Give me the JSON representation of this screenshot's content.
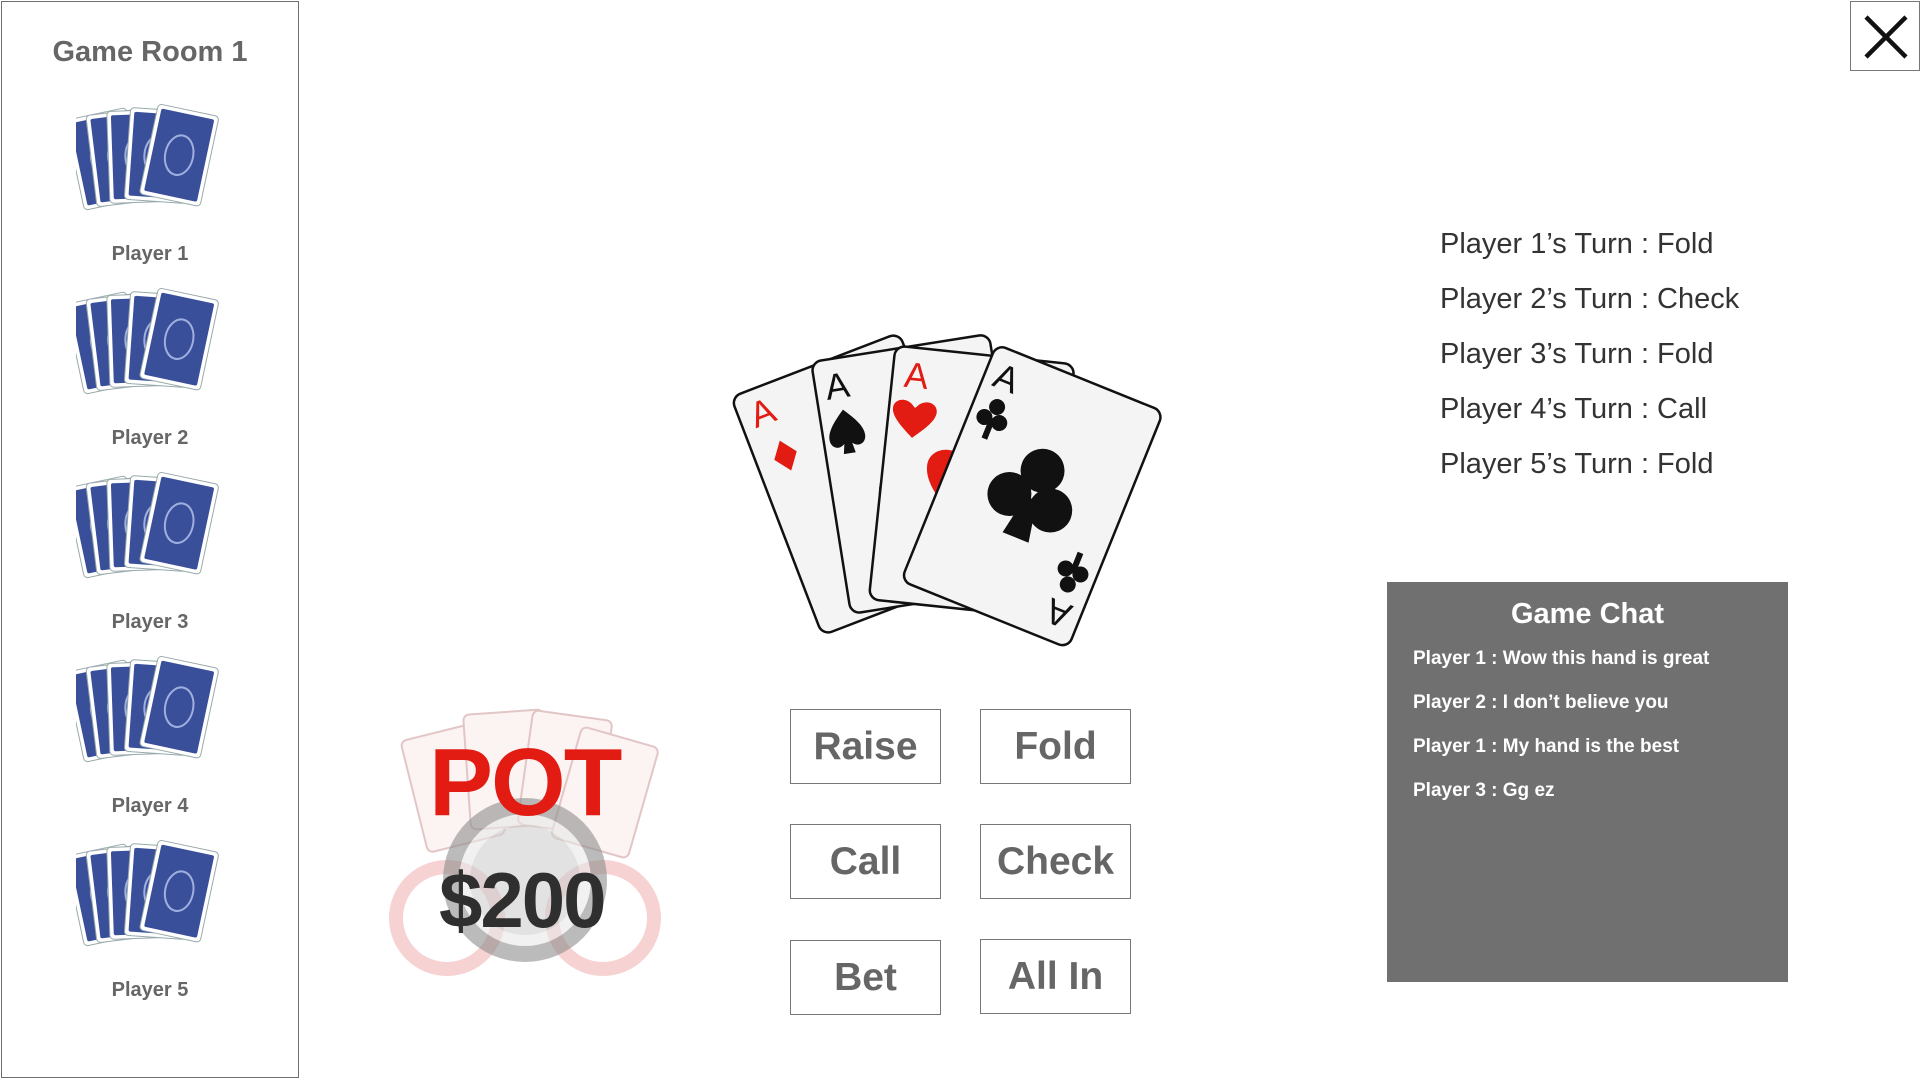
{
  "sidebar": {
    "room_title": "Game Room 1",
    "players": [
      {
        "label": "Player 1"
      },
      {
        "label": "Player 2"
      },
      {
        "label": "Player 3"
      },
      {
        "label": "Player 4"
      },
      {
        "label": "Player 5"
      }
    ]
  },
  "hand": {
    "cards": [
      {
        "rank": "A",
        "suit": "diamonds",
        "color": "#e21b13"
      },
      {
        "rank": "A",
        "suit": "spades",
        "color": "#111111"
      },
      {
        "rank": "A",
        "suit": "hearts",
        "color": "#e21b13"
      },
      {
        "rank": "A",
        "suit": "clubs",
        "color": "#111111"
      }
    ]
  },
  "pot": {
    "title": "POT",
    "amount": "$200"
  },
  "actions": {
    "raise": "Raise",
    "fold": "Fold",
    "call": "Call",
    "check": "Check",
    "bet": "Bet",
    "all_in": "All In"
  },
  "turn_log": [
    "Player 1’s Turn : Fold",
    "Player 2’s Turn : Check",
    "Player 3’s Turn : Fold",
    "Player 4’s Turn : Call",
    "Player 5’s Turn : Fold"
  ],
  "chat": {
    "title": "Game Chat",
    "messages": [
      "Player 1 : Wow this hand is great",
      "Player 2 : I don’t believe you",
      "Player 1 : My hand is the best",
      "Player 3 : Gg ez"
    ]
  },
  "colors": {
    "card_back": "#3a4f9a",
    "pot_red": "#e21b13",
    "chat_bg": "#707070"
  }
}
